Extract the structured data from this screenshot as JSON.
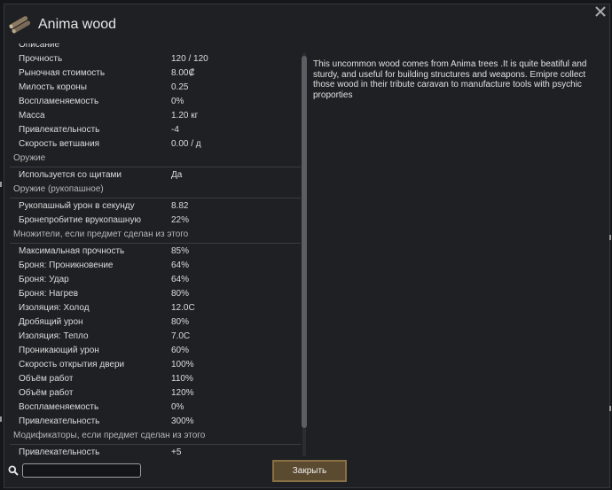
{
  "window": {
    "title": "Anima wood",
    "title_icon": "wood-logs-icon",
    "close_icon": "close-x-icon"
  },
  "stats": {
    "partial_header": "Описание",
    "sections": [
      {
        "header": "",
        "rows": [
          {
            "label": "Прочность",
            "value": "120 / 120"
          },
          {
            "label": "Рыночная стоимость",
            "value": "8.00₡"
          },
          {
            "label": "Милость короны",
            "value": "0.25"
          },
          {
            "label": "Воспламеняемость",
            "value": "0%"
          },
          {
            "label": "Масса",
            "value": "1.20 кг"
          },
          {
            "label": "Привлекательность",
            "value": "-4"
          },
          {
            "label": "Скорость ветшания",
            "value": "0.00 / д"
          }
        ]
      },
      {
        "header": "Оружие",
        "rows": [
          {
            "label": "Используется со щитами",
            "value": "Да"
          }
        ]
      },
      {
        "header": "Оружие (рукопашное)",
        "rows": [
          {
            "label": "Рукопашный урон в секунду",
            "value": "8.82"
          },
          {
            "label": "Бронепробитие врукопашную",
            "value": "22%"
          }
        ]
      },
      {
        "header": "Множители, если предмет сделан из этого",
        "rows": [
          {
            "label": "Максимальная прочность",
            "value": "85%"
          },
          {
            "label": "Броня: Проникновение",
            "value": "64%"
          },
          {
            "label": "Броня: Удар",
            "value": "64%"
          },
          {
            "label": "Броня: Нагрев",
            "value": "80%"
          },
          {
            "label": "Изоляция: Холод",
            "value": "12.0C"
          },
          {
            "label": "Дробящий урон",
            "value": "80%"
          },
          {
            "label": "Изоляция: Тепло",
            "value": "7.0C"
          },
          {
            "label": "Проникающий урон",
            "value": "60%"
          },
          {
            "label": "Скорость открытия двери",
            "value": "100%"
          },
          {
            "label": "Объём работ",
            "value": "110%"
          },
          {
            "label": "Объём работ",
            "value": "120%"
          },
          {
            "label": "Воспламеняемость",
            "value": "0%"
          },
          {
            "label": "Привлекательность",
            "value": "300%"
          }
        ]
      },
      {
        "header": "Модификаторы, если предмет сделан из этого",
        "rows": [
          {
            "label": "Привлекательность",
            "value": "+5"
          }
        ]
      }
    ]
  },
  "description": "This uncommon wood comes from Anima trees .It is quite beatiful and sturdy, and useful for building structures and weapons. Emipre collect those wood in their tribute caravan to manufacture tools with psychic proporties",
  "search": {
    "icon": "magnifier-icon",
    "value": "",
    "placeholder": ""
  },
  "close_button": {
    "label": "Закрыть"
  },
  "colors": {
    "button_fill": "#5a4a30",
    "button_border": "#8a6f44",
    "panel_bg": "#1e2024"
  }
}
